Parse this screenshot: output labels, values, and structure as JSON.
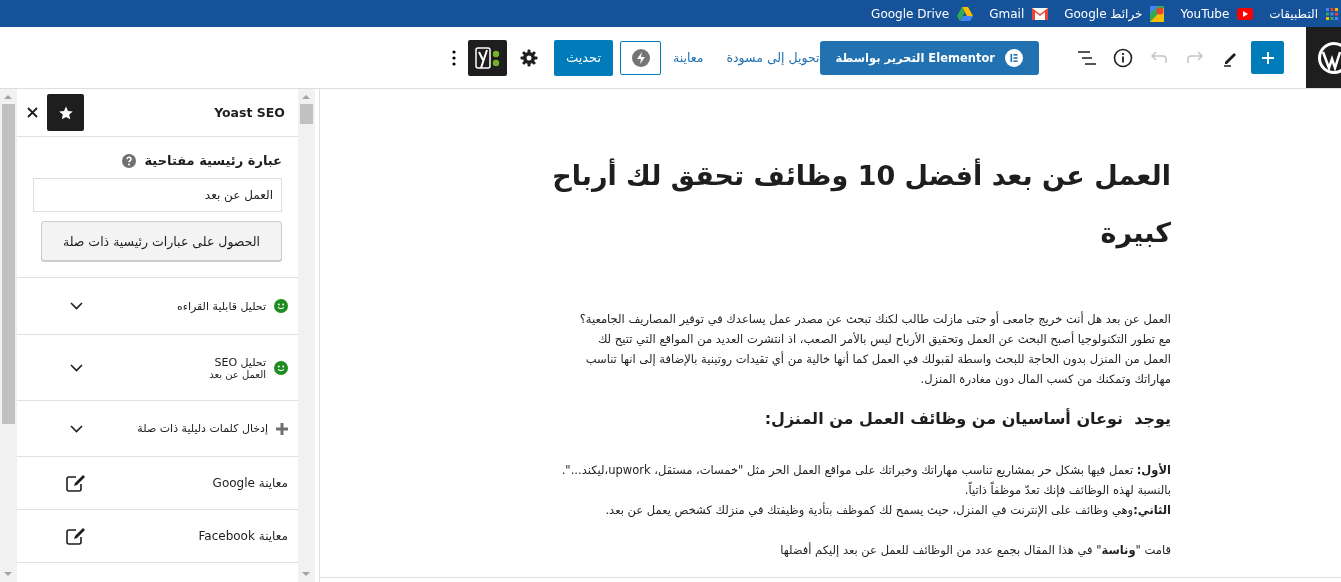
{
  "bookmarks": [
    {
      "label": "التطبيقات",
      "kind": "apps"
    },
    {
      "label": "YouTube",
      "kind": "youtube"
    },
    {
      "label": "خرائط Google",
      "kind": "maps"
    },
    {
      "label": "Gmail",
      "kind": "gmail"
    },
    {
      "label": "Google Drive",
      "kind": "drive"
    }
  ],
  "toolbar": {
    "tools": [
      {
        "kind": "add",
        "disabled": false
      },
      {
        "kind": "edit",
        "disabled": false
      },
      {
        "kind": "redo",
        "disabled": true
      },
      {
        "kind": "undo",
        "disabled": true
      },
      {
        "kind": "info",
        "disabled": false
      },
      {
        "kind": "outline",
        "disabled": false
      }
    ],
    "elementor_button": "التحرير بواسطة Elementor",
    "links": [
      "تحويل إلى مسودة",
      "معاينة"
    ],
    "update_button": "تحديث"
  },
  "sidebar": {
    "title": "Yoast SEO",
    "keyphrase_label": "عبارة رئيسية مفتاحية",
    "keyphrase_value": "العمل عن بعد",
    "related_button": "الحصول على عبارات رئيسية ذات صلة",
    "sections": [
      {
        "kind": "analysis",
        "label": "تحليل قابلية القراءه"
      },
      {
        "kind": "analysis",
        "label": "تحليل SEO",
        "sublabel": "العمل عن بعد"
      },
      {
        "kind": "add",
        "label": "إدخال كلمات دليلية ذات صلة"
      },
      {
        "kind": "preview",
        "label": "معاينة Google"
      },
      {
        "kind": "preview",
        "label": "معاينة Facebook"
      }
    ]
  },
  "post": {
    "title": "العمل عن بعد أفضل 10 وظائف تحقق لك أرباح كبيرة",
    "blocks": [
      {
        "kind": "paragraph",
        "text": "العمل عن بعد هل أنت خريج جامعى أو حتى مازلت طالب لكنك تبحث عن مصدر عمل يساعدك في توفير المصاريف الجامعية؟\nمع تطور التكنولوجيا أصبح البحث عن العمل وتحقيق الأرباح ليس بالأمر الصعب، اذ انتشرت العديد من المواقع التي تتيح لك\nالعمل من المنزل بدون الحاجة للبحث واسطة لقبولك في العمل  كما أنها خالية من أي تقيدات روتينية بالإضافة إلى انها تناسب\nمهاراتك وتمكنك من كسب المال دون مغادرة المنزل."
      },
      {
        "kind": "heading",
        "text": "يوجد  نوعان أساسيان من وظائف العمل من المنزل:"
      },
      {
        "kind": "paragraph",
        "text": "**الأول:** تعمل فيها بشكل حر بمشاريع تناسب مهاراتك وخبراتك على مواقع العمل الحر مثل \"خمسات، مستقل، upwork،ليكند...\".\nبالنسبة لهذه الوظائف فإنك تعدّ موظفاً ذاتياً.\n**الثاني:**وهي وظائف على الإنترنت في المنزل، حيث يسمح لك كموظف بتأدية وظيفتك في منزلك كشخص يعمل عن بعد."
      },
      {
        "kind": "paragraph",
        "text": "قامت \"**وناسة**\" في هذا المقال بجمع عدد من الوظائف للعمل عن بعد إليكم أفضلها"
      }
    ]
  }
}
